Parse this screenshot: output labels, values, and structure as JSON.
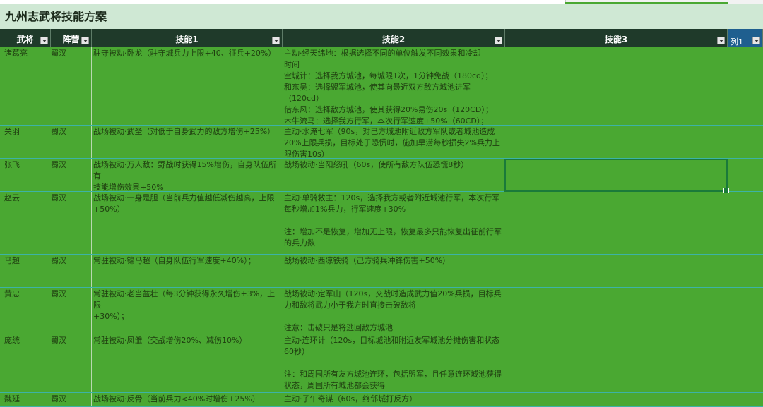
{
  "sheet_title": "九州志武将技能方案",
  "columns": [
    {
      "label": "武将"
    },
    {
      "label": "阵营"
    },
    {
      "label": "技能1"
    },
    {
      "label": "技能2"
    },
    {
      "label": "技能3"
    },
    {
      "label": "列1"
    }
  ],
  "rows": [
    {
      "name": "诸葛亮",
      "faction": "蜀汉",
      "skill1": "驻守被动·卧龙（驻守城兵力上限+40、征兵+20%）",
      "skill2": "主动·经天纬地：根据选择不同的单位触发不同效果和冷却\n时间\n空城计：选择我方城池，每城限1次，1分钟免战（180cd）；\n和东吴：选择盟军城池，使其向最近双方敌方城池进军\n（120cd）\n借东风：选择敌方城池，使其获得20%易伤20s（120CD）；\n木牛流马：选择我方行军，本次行军速度+50%（60CD）；",
      "skill3": "",
      "extra": ""
    },
    {
      "name": "关羽",
      "faction": "蜀汉",
      "skill1": "战场被动·武圣（对低于自身武力的敌方增伤+25%）",
      "skill2": "主动·水淹七军（90s，对己方城池附近敌方军队或者城池造成\n20%上限兵损，目标处于恐慌时，施加旱涝每秒损失2%兵力上\n限伤害10s）",
      "skill3": "",
      "extra": ""
    },
    {
      "name": "张飞",
      "faction": "蜀汉",
      "skill1": "战场被动·万人敌：野战时获得15%增伤，自身队伍所有\n技能增伤效果+50%",
      "skill2": "战场被动·当阳怒吼（60s，使所有敌方队伍恐慌8秒）",
      "skill3": "",
      "extra": ""
    },
    {
      "name": "赵云",
      "faction": "蜀汉",
      "skill1": "战场被动·一身是胆（当前兵力值越低减伤越高，上限\n+50%）",
      "skill2": "主动·单骑救主：120s，选择我方或者附近城池行军，本次行军\n每秒增加1%兵力，行军速度+30%\n\n注：增加不是恢复，增加无上限，恢复最多只能恢复出征前行军\n的兵力数",
      "skill3": "",
      "extra": ""
    },
    {
      "name": "马超",
      "faction": "蜀汉",
      "skill1": "常驻被动·锦马超（自身队伍行军速度+40%）；",
      "skill2": "战场被动·西凉铁骑（己方骑兵冲锋伤害+50%）",
      "skill3": "",
      "extra": ""
    },
    {
      "name": "黄忠",
      "faction": "蜀汉",
      "skill1": "常驻被动·老当益壮（每3分钟获得永久增伤+3%，上限\n+30%）；",
      "skill2": "战场被动·定军山（120s，交战时造成武力值20%兵损，目标兵\n力和敌将武力小于我方时直接击破敌将\n\n注意：击破只是将逃回敌方城池",
      "skill3": "",
      "extra": ""
    },
    {
      "name": "庞统",
      "faction": "蜀汉",
      "skill1": "常驻被动·凤雏（交战增伤20%、减伤10%）",
      "skill2": "主动·连环计（120s，目标城池和附近友军城池分摊伤害和状态\n60秒）\n\n注：和周围所有友方城池连环，包括盟军，且任意连环城池获得\n状态，周围所有城池都会获得",
      "skill3": "",
      "extra": ""
    },
    {
      "name": "魏延",
      "faction": "蜀汉",
      "skill1": "战场被动·反骨（当前兵力<40%时增伤+25%）",
      "skill2": "主动·子午奇谋（60s，终邻城打反方）",
      "skill3": "",
      "extra": ""
    }
  ]
}
